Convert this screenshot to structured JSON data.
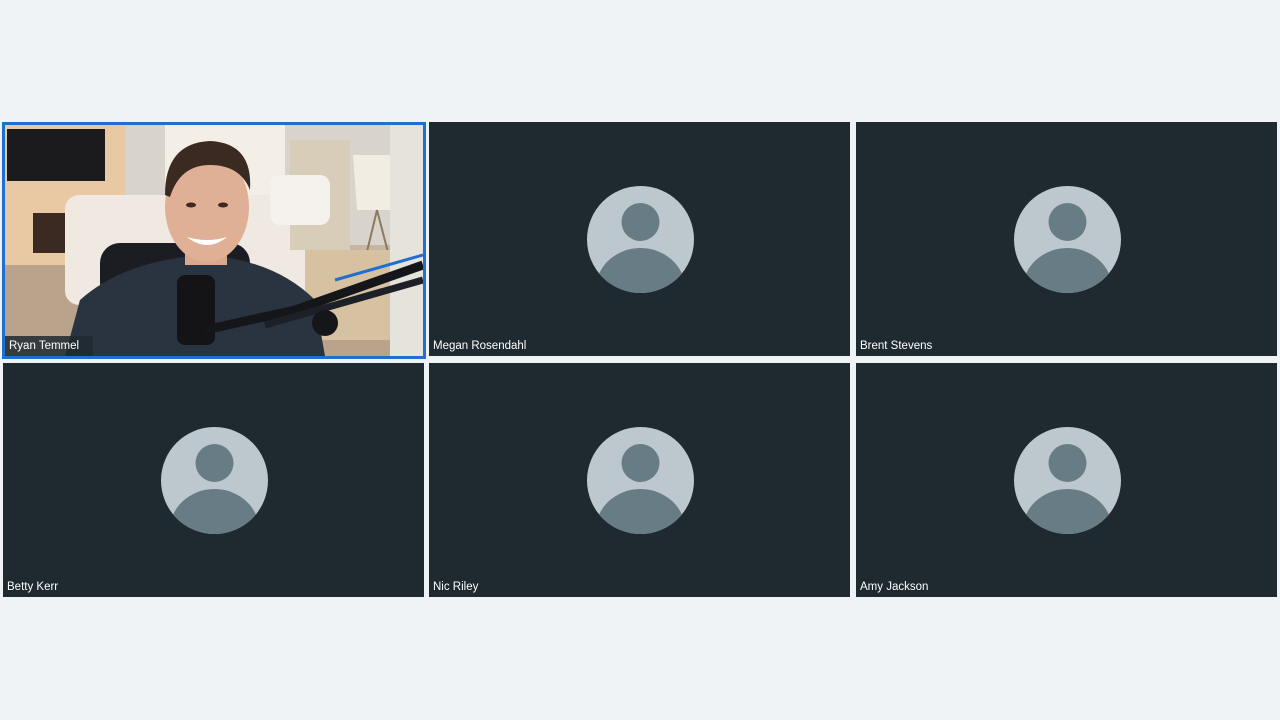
{
  "participants": [
    {
      "name": "Ryan Temmel",
      "video_on": true,
      "active_speaker": true
    },
    {
      "name": "Megan Rosendahl",
      "video_on": false,
      "active_speaker": false
    },
    {
      "name": "Brent Stevens",
      "video_on": false,
      "active_speaker": false
    },
    {
      "name": "Betty Kerr",
      "video_on": false,
      "active_speaker": false
    },
    {
      "name": "Nic Riley",
      "video_on": false,
      "active_speaker": false
    },
    {
      "name": "Amy Jackson",
      "video_on": false,
      "active_speaker": false
    }
  ],
  "colors": {
    "background": "#f0f3f6",
    "tile": "#1e2a30",
    "active_border": "#1f6fd1",
    "avatar_light": "#bcc8ce",
    "avatar_dark": "#687c86"
  },
  "icons": {
    "placeholder": "person-avatar-icon"
  }
}
